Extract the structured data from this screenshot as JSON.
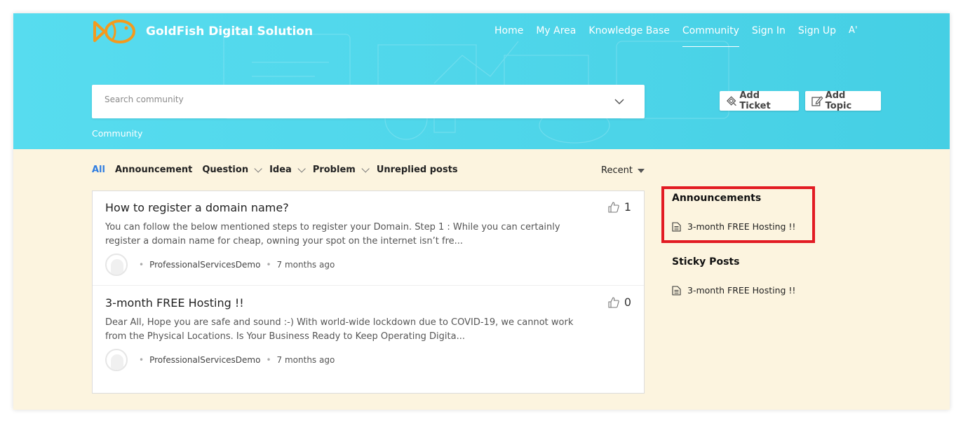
{
  "brand": {
    "name": "GoldFish Digital Solution"
  },
  "nav": {
    "items": [
      {
        "label": "Home"
      },
      {
        "label": "My Area"
      },
      {
        "label": "Knowledge Base"
      },
      {
        "label": "Community"
      },
      {
        "label": "Sign In"
      },
      {
        "label": "Sign Up"
      },
      {
        "label": "A'"
      }
    ],
    "active": "Community"
  },
  "search": {
    "placeholder": "Search community"
  },
  "breadcrumb": "Community",
  "actions": {
    "add_ticket": "Add Ticket",
    "add_topic": "Add Topic"
  },
  "filters": {
    "items": [
      {
        "label": "All"
      },
      {
        "label": "Announcement"
      },
      {
        "label": "Question"
      },
      {
        "label": "Idea"
      },
      {
        "label": "Problem"
      },
      {
        "label": "Unreplied posts"
      }
    ],
    "sort": "Recent"
  },
  "posts": [
    {
      "title": "How to register a domain name?",
      "snippet": "You can follow the below mentioned steps to register your Domain. Step 1 : While you can certainly register a domain name for cheap, owning your spot on the internet isn’t fre...",
      "author": "ProfessionalServicesDemo",
      "time": "7 months ago",
      "likes": "1"
    },
    {
      "title": "3-month FREE Hosting !!",
      "snippet": "Dear All, Hope you are safe and sound :-) With world-wide lockdown due to COVID-19, we cannot work from the Physical Locations. Is Your Business Ready to Keep Operating Digita...",
      "author": "ProfessionalServicesDemo",
      "time": "7 months ago",
      "likes": "0"
    }
  ],
  "sidebar": {
    "announcements_title": "Announcements",
    "announcements": [
      {
        "label": "3-month FREE Hosting !!"
      }
    ],
    "sticky_title": "Sticky Posts",
    "sticky": [
      {
        "label": "3-month FREE Hosting !!"
      }
    ]
  },
  "colors": {
    "hero": "#4fd6ea",
    "content_bg": "#fcf4df",
    "active_filter": "#2f7de1",
    "highlight": "#e21b23",
    "logo": "#f39a1e"
  }
}
